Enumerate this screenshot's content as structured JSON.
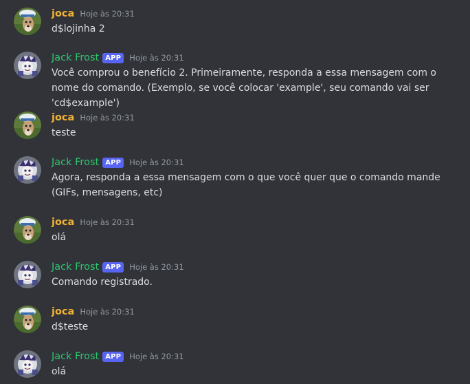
{
  "colors": {
    "background": "#313338",
    "user_name": "#f0b232",
    "bot_name": "#2dc770",
    "app_badge": "#5865f2",
    "timestamp": "#949ba4",
    "text": "#dbdee1"
  },
  "messages": [
    {
      "author": "joca",
      "badge": "",
      "timestamp": "Hoje às 20:31",
      "text": "d$lojinha 2",
      "avatar_icon": "dog-avatar-icon"
    },
    {
      "author": "Jack Frost",
      "badge": "APP",
      "timestamp": "Hoje às 20:31",
      "text": "Você comprou o benefício 2. Primeiramente, responda a essa mensagem com o nome do comando. (Exemplo, se você colocar 'example', seu comando vai ser 'cd$example')",
      "avatar_icon": "bot-avatar-icon"
    },
    {
      "author": "joca",
      "badge": "",
      "timestamp": "Hoje às 20:31",
      "text": "teste",
      "avatar_icon": "dog-avatar-icon"
    },
    {
      "author": "Jack Frost",
      "badge": "APP",
      "timestamp": "Hoje às 20:31",
      "text": "Agora, responda a essa mensagem com o que você quer que o comando mande (GIFs, mensagens, etc)",
      "avatar_icon": "bot-avatar-icon"
    },
    {
      "author": "joca",
      "badge": "",
      "timestamp": "Hoje às 20:31",
      "text": "olá",
      "avatar_icon": "dog-avatar-icon"
    },
    {
      "author": "Jack Frost",
      "badge": "APP",
      "timestamp": "Hoje às 20:31",
      "text": "Comando registrado.",
      "avatar_icon": "bot-avatar-icon"
    },
    {
      "author": "joca",
      "badge": "",
      "timestamp": "Hoje às 20:31",
      "text": "d$teste",
      "avatar_icon": "dog-avatar-icon"
    },
    {
      "author": "Jack Frost",
      "badge": "APP",
      "timestamp": "Hoje às 20:31",
      "text": "olá",
      "avatar_icon": "bot-avatar-icon"
    }
  ]
}
